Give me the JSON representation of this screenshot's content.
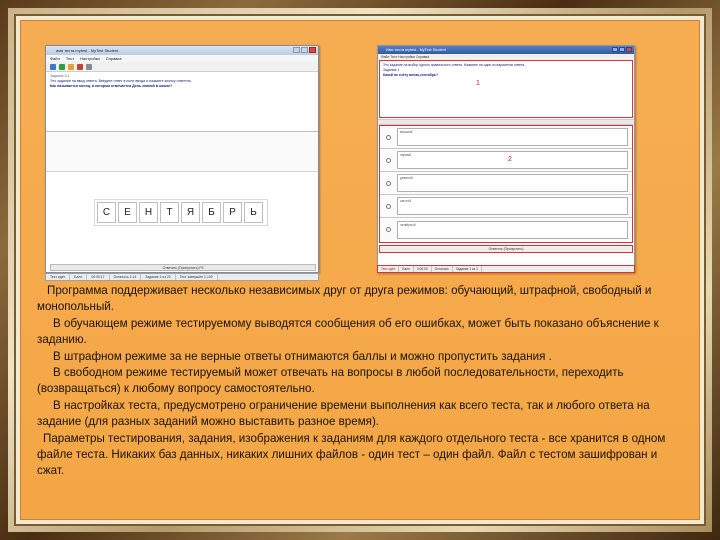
{
  "shot1": {
    "window_title": "имя теста.mytest - MyTest Student",
    "menu": [
      "Файл",
      "Тест",
      "Настройки",
      "Справка"
    ],
    "question_label": "Задание 1/1",
    "question_text": "Это задание на ввод ответа. Введите ответ в поле ввода и нажмите кнопку ответить.",
    "question_prompt": "Как называется месяц, в котором отмечается День знаний в школе?",
    "letters": [
      "С",
      "Е",
      "Н",
      "Т",
      "Я",
      "Б",
      "Р",
      "Ь"
    ],
    "answer_button": "Ответить (Пропустить) F9",
    "status": [
      "Тест идёт",
      "Балл",
      "00:00:17",
      "Осталось 1:14",
      "Задание 1 из 20",
      "Тест завершён 1-100"
    ]
  },
  "shot2": {
    "window_title": "Имя теста.mytest - MyTest Student",
    "menu": "Файл  Тест  Настройки  Справка",
    "question_text": "Это задание на выбор одного правильного ответа. Нажмите на один из вариантов ответа.",
    "question_sub": "Задание 1",
    "question_prompt": "Какой по счёту месяц сентябрь?",
    "marker1": "1",
    "options": [
      "восьмой",
      "первый",
      "девятый",
      "шестой",
      "четвёртый"
    ],
    "marker2": "2",
    "answer_button": "Ответить (Пропустить)",
    "status": [
      "Тест идёт",
      "Балл",
      "0:00:00",
      "Осталось",
      "Задание 1 из 1"
    ]
  },
  "text": {
    "p1": "Программа поддерживает несколько независимых друг от друга режимов: обучающий, штрафной, свободный и монопольный.",
    "p2": "В обучающем режиме тестируемому выводятся сообщения об его ошибках, может быть показано объяснение к заданию.",
    "p3": "В штрафном режиме за не верные ответы  отнимаются баллы и можно пропустить задания .",
    "p4": "В свободном режиме тестируемый может отвечать на вопросы в любой последовательности, переходить (возвращаться) к любому вопросу самостоятельно.",
    "p5": "В настройках теста, предусмотрено ограничение времени выполнения как всего теста, так и любого ответа на задание (для разных заданий можно выставить разное время).",
    "p6": "Параметры тестирования, задания, изображения к заданиям для каждого отдельного теста - все хранится в одном файле теста. Никаких баз данных, никаких лишних файлов - один тест – один файл. Файл с тестом зашифрован и сжат."
  }
}
